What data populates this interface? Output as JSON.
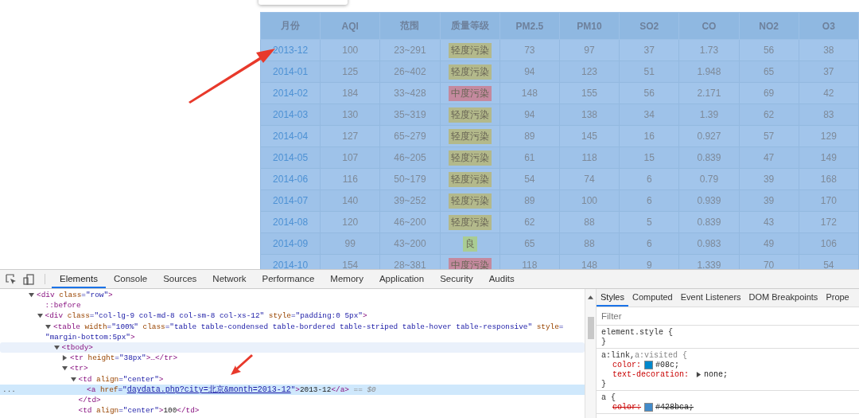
{
  "aqi_table": {
    "columns": [
      "月份",
      "AQI",
      "范围",
      "质量等级",
      "PM2.5",
      "PM10",
      "SO2",
      "CO",
      "NO2",
      "O3"
    ],
    "rows": [
      {
        "month": "2013-12",
        "aqi": "100",
        "range": "23~291",
        "quality": {
          "label": "轻度污染",
          "color": "#b3b98b"
        },
        "values": [
          "73",
          "97",
          "37",
          "1.73",
          "56",
          "38"
        ]
      },
      {
        "month": "2014-01",
        "aqi": "125",
        "range": "26~402",
        "quality": {
          "label": "轻度污染",
          "color": "#b3b98b"
        },
        "values": [
          "94",
          "123",
          "51",
          "1.948",
          "65",
          "37"
        ]
      },
      {
        "month": "2014-02",
        "aqi": "184",
        "range": "33~428",
        "quality": {
          "label": "中度污染",
          "color": "#c4899e"
        },
        "values": [
          "148",
          "155",
          "56",
          "2.171",
          "69",
          "42"
        ]
      },
      {
        "month": "2014-03",
        "aqi": "130",
        "range": "35~319",
        "quality": {
          "label": "轻度污染",
          "color": "#b3b98b"
        },
        "values": [
          "94",
          "138",
          "34",
          "1.39",
          "62",
          "83"
        ]
      },
      {
        "month": "2014-04",
        "aqi": "127",
        "range": "65~279",
        "quality": {
          "label": "轻度污染",
          "color": "#b3b98b"
        },
        "values": [
          "89",
          "145",
          "16",
          "0.927",
          "57",
          "129"
        ]
      },
      {
        "month": "2014-05",
        "aqi": "107",
        "range": "46~205",
        "quality": {
          "label": "轻度污染",
          "color": "#b3b98b"
        },
        "values": [
          "61",
          "118",
          "15",
          "0.839",
          "47",
          "149"
        ]
      },
      {
        "month": "2014-06",
        "aqi": "116",
        "range": "50~179",
        "quality": {
          "label": "轻度污染",
          "color": "#b3b98b"
        },
        "values": [
          "54",
          "74",
          "6",
          "0.79",
          "39",
          "168"
        ]
      },
      {
        "month": "2014-07",
        "aqi": "140",
        "range": "39~252",
        "quality": {
          "label": "轻度污染",
          "color": "#b3b98b"
        },
        "values": [
          "89",
          "100",
          "6",
          "0.939",
          "39",
          "170"
        ]
      },
      {
        "month": "2014-08",
        "aqi": "120",
        "range": "46~200",
        "quality": {
          "label": "轻度污染",
          "color": "#b3b98b"
        },
        "values": [
          "62",
          "88",
          "5",
          "0.839",
          "43",
          "172"
        ]
      },
      {
        "month": "2014-09",
        "aqi": "99",
        "range": "43~200",
        "quality": {
          "label": "良",
          "color": "#a9cc93"
        },
        "values": [
          "65",
          "88",
          "6",
          "0.983",
          "49",
          "106"
        ]
      },
      {
        "month": "2014-10",
        "aqi": "154",
        "range": "28~381",
        "quality": {
          "label": "中度污染",
          "color": "#c4899e"
        },
        "values": [
          "118",
          "148",
          "9",
          "1.339",
          "70",
          "54"
        ]
      }
    ]
  },
  "devtools": {
    "tabs": [
      {
        "label": "Elements",
        "selected": true
      },
      {
        "label": "Console",
        "selected": false
      },
      {
        "label": "Sources",
        "selected": false
      },
      {
        "label": "Network",
        "selected": false
      },
      {
        "label": "Performance",
        "selected": false
      },
      {
        "label": "Memory",
        "selected": false
      },
      {
        "label": "Application",
        "selected": false
      },
      {
        "label": "Security",
        "selected": false
      },
      {
        "label": "Audits",
        "selected": false
      }
    ],
    "dom_tree": [
      {
        "kind": "open",
        "selected": false,
        "hovered": false,
        "lines": [
          [
            {
              "kind": "tag",
              "text": "<div"
            },
            {
              "kind": "attr",
              "text": " class"
            },
            {
              "kind": "value",
              "text": "=\"row\""
            },
            {
              "kind": "tag",
              "text": ">"
            }
          ]
        ],
        "children": [
          {
            "kind": "leaf",
            "selected": false,
            "hovered": false,
            "lines": [
              [
                {
                  "kind": "tag",
                  "text": "::before"
                }
              ]
            ]
          },
          {
            "kind": "open",
            "selected": false,
            "hovered": false,
            "lines": [
              [
                {
                  "kind": "tag",
                  "text": "<div"
                },
                {
                  "kind": "attr",
                  "text": " class"
                },
                {
                  "kind": "value",
                  "text": "=\"col-lg-9 col-md-8 col-sm-8 col-xs-12\""
                },
                {
                  "kind": "attr",
                  "text": " style"
                },
                {
                  "kind": "value",
                  "text": "=\"padding:0 5px\""
                },
                {
                  "kind": "tag",
                  "text": ">"
                }
              ]
            ],
            "children": [
              {
                "kind": "open",
                "selected": false,
                "hovered": false,
                "lines": [
                  [
                    {
                      "kind": "tag",
                      "text": "<table"
                    },
                    {
                      "kind": "attr",
                      "text": " width"
                    },
                    {
                      "kind": "value",
                      "text": "=\"100%\""
                    },
                    {
                      "kind": "attr",
                      "text": " class"
                    },
                    {
                      "kind": "value",
                      "text": "=\"table table-condensed table-bordered table-striped table-hover table-responsive\""
                    },
                    {
                      "kind": "attr",
                      "text": " style"
                    },
                    {
                      "kind": "value",
                      "text": "="
                    }
                  ],
                  [
                    {
                      "kind": "value",
                      "text": "\"margin-bottom:5px\""
                    },
                    {
                      "kind": "tag",
                      "text": ">"
                    }
                  ]
                ],
                "children": [
                  {
                    "kind": "open",
                    "selected": false,
                    "hovered": true,
                    "lines": [
                      [
                        {
                          "kind": "tag",
                          "text": "<tbody>"
                        }
                      ]
                    ],
                    "children": [
                      {
                        "kind": "closed",
                        "selected": false,
                        "hovered": false,
                        "lines": [
                          [
                            {
                              "kind": "tag",
                              "text": "<tr"
                            },
                            {
                              "kind": "attr",
                              "text": " height"
                            },
                            {
                              "kind": "value",
                              "text": "=\"38px\""
                            },
                            {
                              "kind": "tag",
                              "text": ">…</tr>"
                            }
                          ]
                        ]
                      },
                      {
                        "kind": "open",
                        "selected": false,
                        "hovered": false,
                        "lines": [
                          [
                            {
                              "kind": "tag",
                              "text": "<tr>"
                            }
                          ]
                        ],
                        "children": [
                          {
                            "kind": "open",
                            "selected": false,
                            "hovered": false,
                            "lines": [
                              [
                                {
                                  "kind": "tag",
                                  "text": "<td"
                                },
                                {
                                  "kind": "attr",
                                  "text": " align"
                                },
                                {
                                  "kind": "value",
                                  "text": "=\"center\""
                                },
                                {
                                  "kind": "tag",
                                  "text": ">"
                                }
                              ]
                            ],
                            "close": [
                              {
                                "kind": "tag",
                                "text": "</td>"
                              }
                            ],
                            "children": [
                              {
                                "kind": "leaf",
                                "selected": true,
                                "hovered": false,
                                "gutter": "...",
                                "lines": [
                                  [
                                    {
                                      "kind": "tag",
                                      "text": "<a"
                                    },
                                    {
                                      "kind": "attr",
                                      "text": " href"
                                    },
                                    {
                                      "kind": "value",
                                      "text": "=\""
                                    },
                                    {
                                      "kind": "link",
                                      "text": "daydata.php?city=北京&month=2013-12"
                                    },
                                    {
                                      "kind": "value",
                                      "text": "\""
                                    },
                                    {
                                      "kind": "tag",
                                      "text": ">"
                                    },
                                    {
                                      "kind": "text",
                                      "text": "2013-12"
                                    },
                                    {
                                      "kind": "tag",
                                      "text": "</a>"
                                    },
                                    {
                                      "kind": "dim",
                                      "text": " == $0"
                                    }
                                  ]
                                ]
                              }
                            ]
                          },
                          {
                            "kind": "leaf",
                            "selected": false,
                            "hovered": false,
                            "lines": [
                              [
                                {
                                  "kind": "tag",
                                  "text": "<td"
                                },
                                {
                                  "kind": "attr",
                                  "text": " align"
                                },
                                {
                                  "kind": "value",
                                  "text": "=\"center\""
                                },
                                {
                                  "kind": "tag",
                                  "text": ">"
                                },
                                {
                                  "kind": "text",
                                  "text": "100"
                                },
                                {
                                  "kind": "tag",
                                  "text": "</td>"
                                }
                              ]
                            ]
                          }
                        ]
                      }
                    ]
                  }
                ]
              }
            ]
          }
        ]
      }
    ],
    "sidebar_tabs": [
      {
        "label": "Styles",
        "selected": true
      },
      {
        "label": "Computed",
        "selected": false
      },
      {
        "label": "Event Listeners",
        "selected": false
      },
      {
        "label": "DOM Breakpoints",
        "selected": false
      },
      {
        "label": "Prope",
        "selected": false
      }
    ],
    "filter": {
      "placeholder": "Filter"
    },
    "style_rules": [
      {
        "selector": [
          {
            "text": "element.style {",
            "matched": true
          }
        ],
        "close": "}"
      },
      {
        "selector": [
          {
            "text": "a:link,",
            "matched": true
          },
          {
            "text": "a:visited {",
            "matched": false
          }
        ],
        "declarations": [
          {
            "property": "color:",
            "value": "#08c;",
            "color": "#0088cc",
            "expandable": false,
            "struck": false
          },
          {
            "property": "text-decoration:",
            "value": "none;",
            "expandable": true,
            "struck": false
          }
        ],
        "close": "}"
      },
      {
        "selector": [
          {
            "text": "a {",
            "matched": true
          }
        ],
        "declarations": [
          {
            "property": "color:",
            "value": "#428bca;",
            "color": "#428bca",
            "expandable": false,
            "struck": true
          }
        ]
      }
    ]
  }
}
